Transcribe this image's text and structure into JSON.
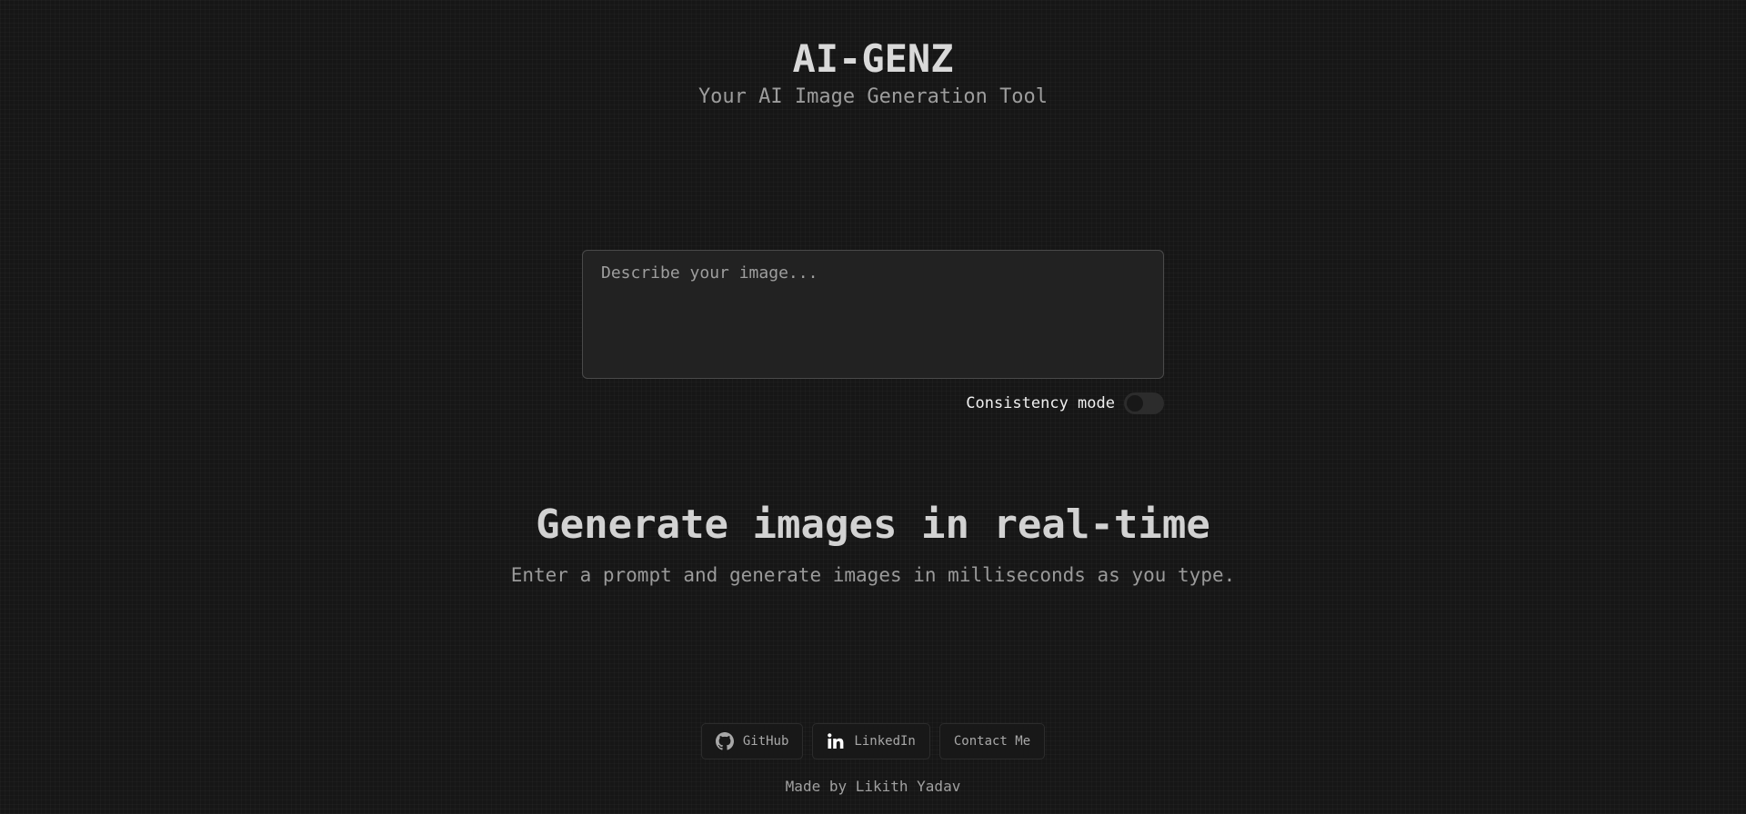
{
  "header": {
    "title": "AI-GENZ",
    "subtitle": "Your AI Image Generation Tool"
  },
  "prompt": {
    "placeholder": "Describe your image...",
    "value": ""
  },
  "consistency": {
    "label": "Consistency mode",
    "enabled": false
  },
  "hero": {
    "title": "Generate images in real-time",
    "subtitle": "Enter a prompt and generate images in milliseconds as you type."
  },
  "footer": {
    "links": [
      {
        "label": "GitHub",
        "icon": "github-icon"
      },
      {
        "label": "LinkedIn",
        "icon": "linkedin-icon"
      },
      {
        "label": "Contact Me",
        "icon": ""
      }
    ],
    "credit": "Made by Likith Yadav"
  },
  "colors": {
    "background": "#161616",
    "input_background": "#222222",
    "input_border": "#4a4a4a",
    "text_primary": "#d9d9d9",
    "text_muted": "#9d9d9d"
  }
}
